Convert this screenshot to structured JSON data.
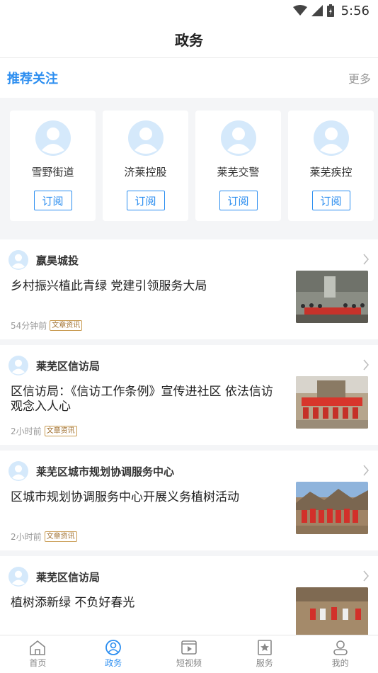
{
  "status_bar": {
    "time": "5:56"
  },
  "header": {
    "title": "政务"
  },
  "recommend": {
    "title": "推荐关注",
    "more_label": "更多",
    "cards": [
      {
        "name": "雪野街道",
        "subscribe_label": "订阅"
      },
      {
        "name": "济莱控股",
        "subscribe_label": "订阅"
      },
      {
        "name": "莱芜交警",
        "subscribe_label": "订阅"
      },
      {
        "name": "莱芜疾控",
        "subscribe_label": "订阅"
      }
    ]
  },
  "feed": [
    {
      "source": "嬴昊城投",
      "title": "乡村振兴植此青绿  党建引领服务大局",
      "time": "54分钟前",
      "tag": "文章资讯"
    },
    {
      "source": "莱芜区信访局",
      "title": "区信访局：《信访工作条例》宣传进社区  依法信访观念入人心",
      "time": "2小时前",
      "tag": "文章资讯"
    },
    {
      "source": "莱芜区城市规划协调服务中心",
      "title": "区城市规划协调服务中心开展义务植树活动",
      "time": "2小时前",
      "tag": "文章资讯"
    },
    {
      "source": "莱芜区信访局",
      "title": "植树添新绿  不负好春光",
      "time": "",
      "tag": ""
    }
  ],
  "tabs": [
    {
      "label": "首页",
      "icon": "home-icon",
      "active": false
    },
    {
      "label": "政务",
      "icon": "government-icon",
      "active": true
    },
    {
      "label": "短视频",
      "icon": "video-icon",
      "active": false
    },
    {
      "label": "服务",
      "icon": "service-icon",
      "active": false
    },
    {
      "label": "我的",
      "icon": "profile-icon",
      "active": false
    }
  ],
  "colors": {
    "accent": "#2c8ef0",
    "tag": "#a07030",
    "background": "#f4f5f7"
  }
}
